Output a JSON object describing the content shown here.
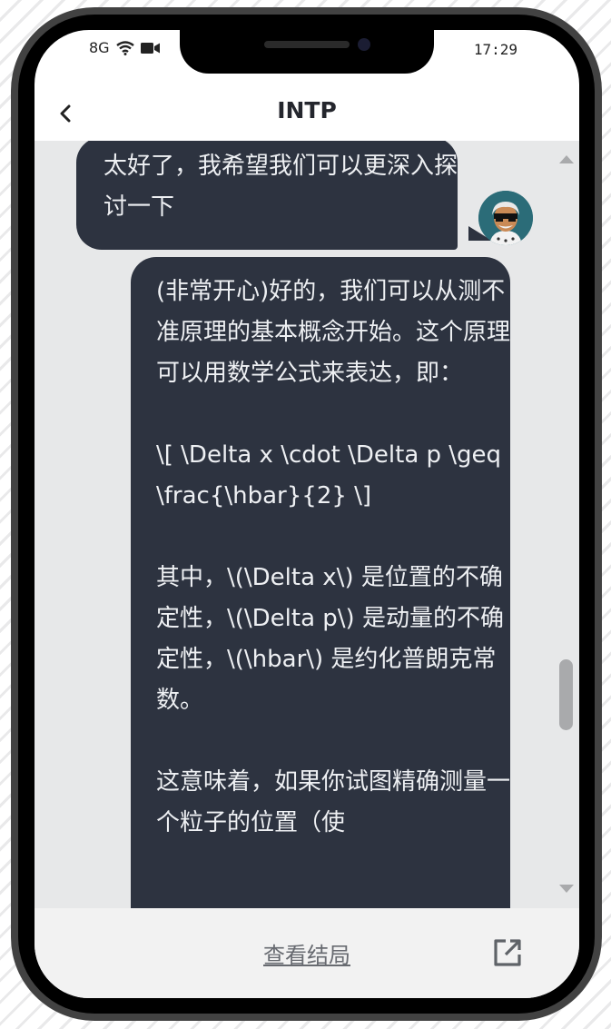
{
  "status_bar": {
    "network": "8G",
    "time": "17:29"
  },
  "header": {
    "title": "INTP"
  },
  "messages": [
    {
      "text": "太好了，我希望我们可以更深入探讨一下"
    },
    {
      "text": "(非常开心)好的，我们可以从测不准原理的基本概念开始。这个原理可以用数学公式来表达，即：\n\n\\[ \\Delta x \\cdot \\Delta p \\geq \\frac{\\hbar}{2} \\]\n\n其中，\\(\\Delta x\\) 是位置的不确定性，\\(\\Delta p\\) 是动量的不确定性，\\(\\hbar\\) 是约化普朗克常数。\n\n这意味着，如果你试图精确测量一个粒子的位置（使"
    }
  ],
  "footer": {
    "view_ending_label": "查看结局"
  },
  "colors": {
    "bubble": "#2d3340",
    "chat_bg": "#e7e8e9",
    "avatar_bg": "#2b6c78"
  }
}
